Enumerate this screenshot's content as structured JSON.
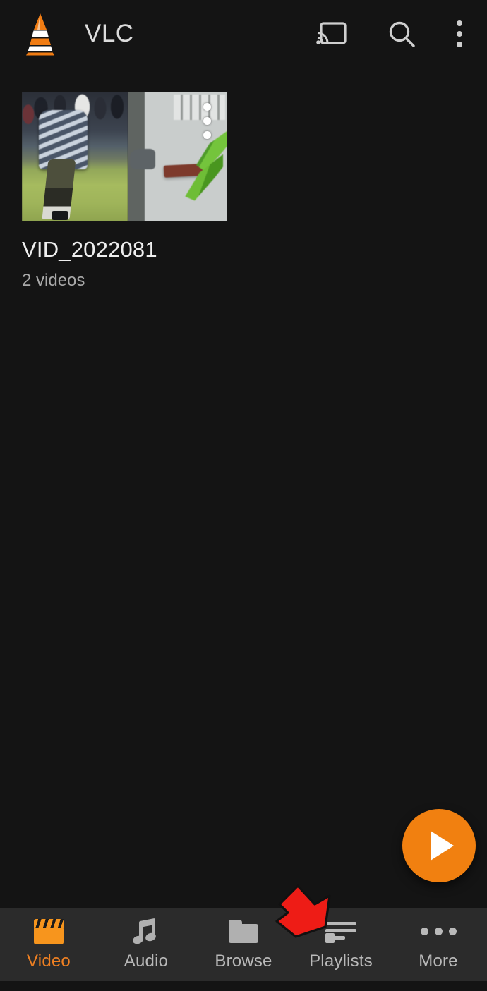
{
  "app": {
    "name": "VLC",
    "logo_icon": "vlc-cone-icon",
    "background_color": "#141414",
    "accent_color": "#f18010"
  },
  "appbar": {
    "title": "VLC",
    "actions": [
      {
        "name": "cast-icon",
        "label": "Cast"
      },
      {
        "name": "search-icon",
        "label": "Search"
      },
      {
        "name": "overflow-menu-icon",
        "label": "More options"
      }
    ]
  },
  "content": {
    "videos": [
      {
        "title": "VID_2022081",
        "subtitle": "2 videos",
        "overlay_menu_icon": "three-dot-vertical-icon"
      }
    ]
  },
  "fab": {
    "label": "Play",
    "icon": "play-triangle-icon",
    "color": "#f18010"
  },
  "bottom_nav": {
    "active_index": 0,
    "active_color": "#ef8022",
    "inactive_color": "#b9b9b9",
    "background_color": "#2b2b2b",
    "items": [
      {
        "label": "Video",
        "icon": "clapperboard-icon"
      },
      {
        "label": "Audio",
        "icon": "music-note-icon"
      },
      {
        "label": "Browse",
        "icon": "folder-icon"
      },
      {
        "label": "Playlists",
        "icon": "playlist-icon"
      },
      {
        "label": "More",
        "icon": "three-dot-horizontal-icon"
      }
    ]
  },
  "annotation": {
    "type": "arrow",
    "color": "#ee1c16",
    "outline_color": "#111111",
    "points_to": "Playlists",
    "direction": "down-right"
  }
}
